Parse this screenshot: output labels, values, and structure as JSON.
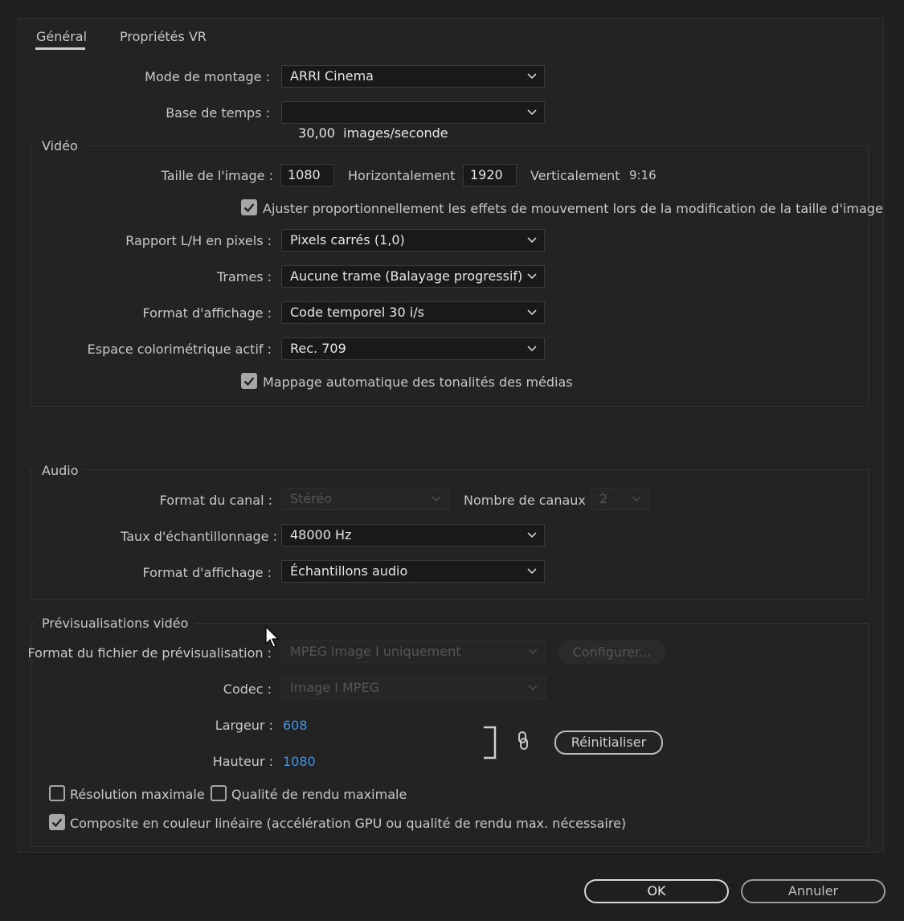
{
  "tabs": [
    "Général",
    "Propriétés VR"
  ],
  "general": {
    "editing_mode": {
      "label": "Mode de montage :",
      "value": "ARRI Cinema"
    },
    "timebase": {
      "label": "Base de temps :",
      "value": "30,00  images/seconde"
    }
  },
  "video": {
    "title": "Vidéo",
    "frame_size": {
      "label": "Taille de l'image :",
      "horizontal_value": "1080",
      "horizontal_label": "Horizontalement",
      "vertical_value": "1920",
      "vertical_label": "Verticalement",
      "ratio": "9:16"
    },
    "scale_motion_checkbox": {
      "label": "Ajuster proportionnellement les effets de mouvement lors de la modification de la taille d'image",
      "checked": true
    },
    "pixel_aspect": {
      "label": "Rapport L/H en pixels :",
      "value": "Pixels carrés (1,0)"
    },
    "fields": {
      "label": "Trames :",
      "value": "Aucune trame (Balayage progressif)"
    },
    "display_format": {
      "label": "Format d'affichage :",
      "value": "Code temporel 30 i/s"
    },
    "color_space": {
      "label": "Espace colorimétrique actif :",
      "value": "Rec. 709"
    },
    "tone_mapping_checkbox": {
      "label": "Mappage automatique des tonalités des médias",
      "checked": true
    }
  },
  "audio": {
    "title": "Audio",
    "channel_format": {
      "label": "Format du canal :",
      "value": "Stéréo"
    },
    "num_channels": {
      "label": "Nombre de canaux :",
      "value": "2"
    },
    "sample_rate": {
      "label": "Taux d'échantillonnage :",
      "value": "48000 Hz"
    },
    "display_format": {
      "label": "Format d'affichage :",
      "value": "Échantillons audio"
    }
  },
  "previews": {
    "title": "Prévisualisations vidéo",
    "file_format": {
      "label": "Format du fichier de prévisualisation :",
      "value": "MPEG image I uniquement"
    },
    "configure_button": "Configurer...",
    "codec": {
      "label": "Codec :",
      "value": "Image I MPEG"
    },
    "width": {
      "label": "Largeur :",
      "value": "608"
    },
    "height": {
      "label": "Hauteur :",
      "value": "1080"
    },
    "reset_button": "Réinitialiser",
    "max_resolution": {
      "label": "Résolution maximale",
      "checked": false
    },
    "max_quality": {
      "label": "Qualité de rendu maximale",
      "checked": false
    },
    "linear_composite": {
      "label": "Composite en couleur linéaire (accélération GPU ou qualité de rendu max. nécessaire)",
      "checked": true
    }
  },
  "buttons": {
    "ok": "OK",
    "cancel": "Annuler"
  },
  "colors": {
    "background": "#1f1f1f",
    "link_value": "#4a90d9",
    "checkbox": "#a7a7a7"
  },
  "icons": [
    "chevron-down-icon",
    "checkmark-icon",
    "link-chain-icon",
    "mouse-cursor-icon"
  ]
}
